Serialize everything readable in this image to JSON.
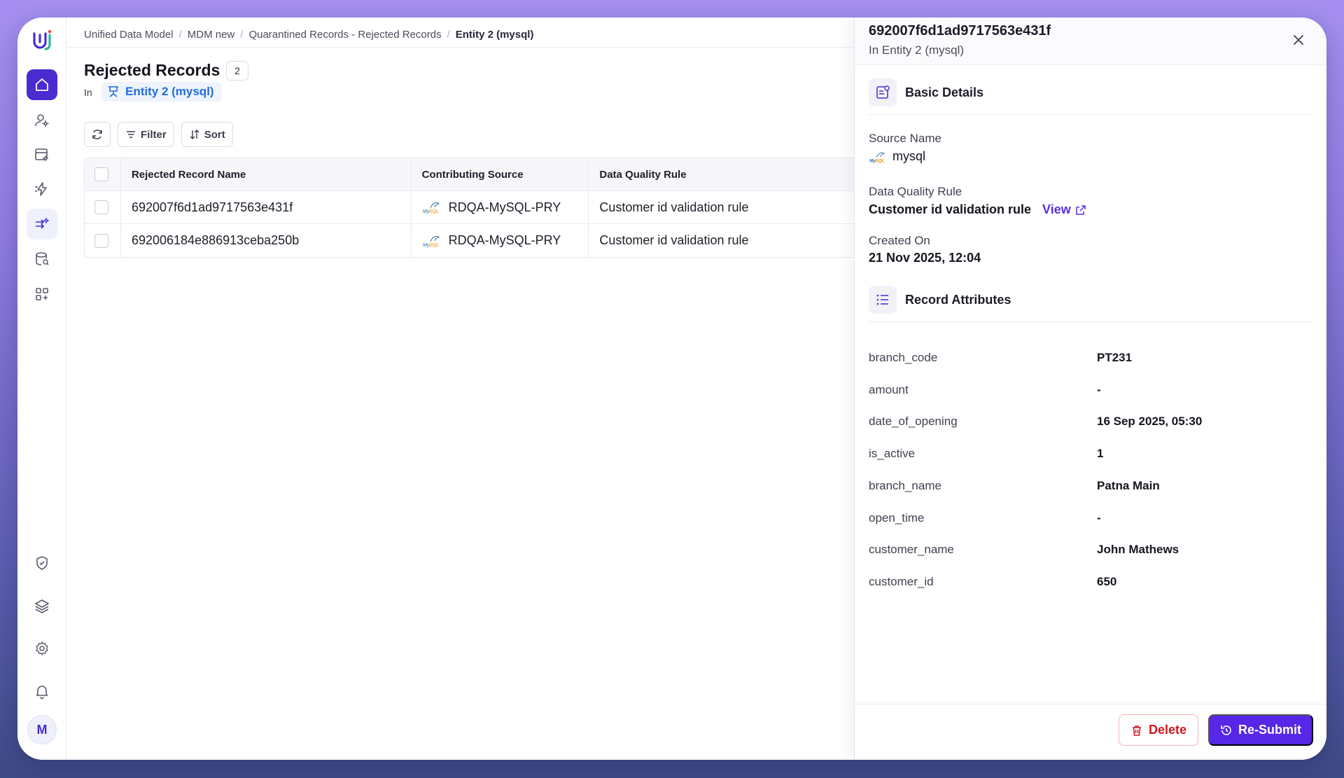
{
  "breadcrumb": {
    "items": [
      "Unified Data Model",
      "MDM new",
      "Quarantined Records - Rejected Records"
    ],
    "current": "Entity 2 (mysql)"
  },
  "page": {
    "title": "Rejected Records",
    "count": "2",
    "in_label": "In",
    "entity": "Entity 2 (mysql)"
  },
  "toolbar": {
    "filter_label": "Filter",
    "sort_label": "Sort"
  },
  "table": {
    "columns": [
      "Rejected Record Name",
      "Contributing Source",
      "Data Quality Rule"
    ],
    "rows": [
      {
        "name": "692007f6d1ad9717563e431f",
        "source": "RDQA-MySQL-PRY",
        "rule": "Customer id validation rule"
      },
      {
        "name": "692006184e886913ceba250b",
        "source": "RDQA-MySQL-PRY",
        "rule": "Customer id validation rule"
      }
    ]
  },
  "panel": {
    "title": "692007f6d1ad9717563e431f",
    "subtitle": "In Entity 2 (mysql)",
    "basic_details": {
      "heading": "Basic Details",
      "source_name_label": "Source Name",
      "source_name_value": "mysql",
      "dq_rule_label": "Data Quality Rule",
      "dq_rule_value": "Customer id validation rule",
      "view_label": "View",
      "created_on_label": "Created On",
      "created_on_value": "21 Nov 2025, 12:04"
    },
    "record_attributes": {
      "heading": "Record Attributes",
      "items": [
        {
          "key": "branch_code",
          "value": "PT231"
        },
        {
          "key": "amount",
          "value": "-"
        },
        {
          "key": "date_of_opening",
          "value": "16 Sep 2025, 05:30"
        },
        {
          "key": "is_active",
          "value": "1"
        },
        {
          "key": "branch_name",
          "value": "Patna Main"
        },
        {
          "key": "open_time",
          "value": "-"
        },
        {
          "key": "customer_name",
          "value": "John Mathews"
        },
        {
          "key": "customer_id",
          "value": "650"
        }
      ]
    },
    "delete_label": "Delete",
    "resubmit_label": "Re-Submit"
  },
  "user": {
    "avatar_initial": "M"
  },
  "colors": {
    "accent": "#5627e6",
    "home_active": "#4a2bd0",
    "link_blue": "#1f6fdc",
    "danger": "#d0171d"
  }
}
